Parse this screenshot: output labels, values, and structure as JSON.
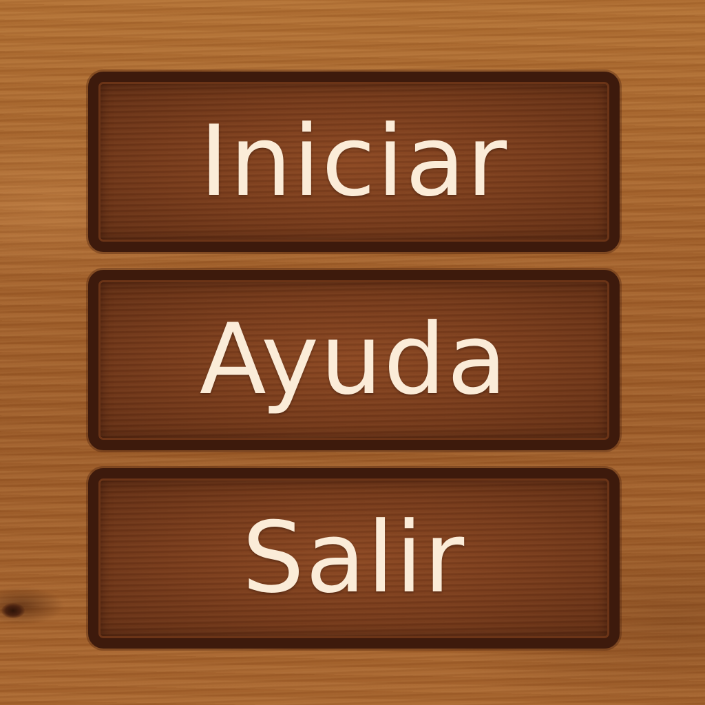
{
  "menu": {
    "items": [
      {
        "label": "Iniciar"
      },
      {
        "label": "Ayuda"
      },
      {
        "label": "Salir"
      }
    ]
  },
  "colors": {
    "wood_background": "#a8652c",
    "button_fill": "#6e3719",
    "button_border": "#3d1a0c",
    "label_text": "#fbecd8"
  }
}
